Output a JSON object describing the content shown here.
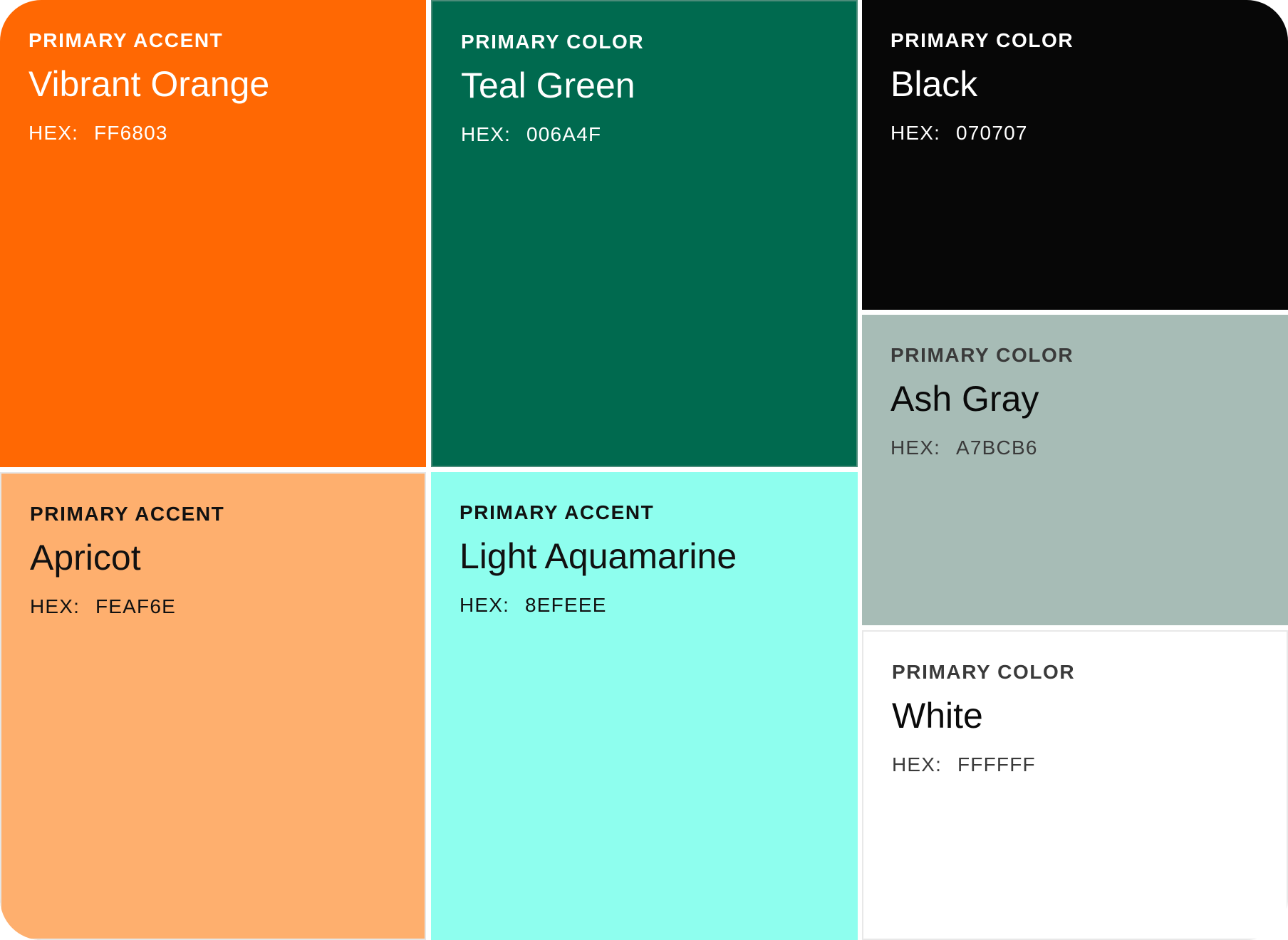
{
  "swatches": [
    {
      "id": "orange",
      "role": "PRIMARY ACCENT",
      "name": "Vibrant Orange",
      "hex_label": "HEX:",
      "hex": "FF6803",
      "bg": "#FF6803",
      "text_color": "#FFFFFF"
    },
    {
      "id": "teal",
      "role": "PRIMARY COLOR",
      "name": "Teal Green",
      "hex_label": "HEX:",
      "hex": "006A4F",
      "bg": "#006A4F",
      "text_color": "#FFFFFF"
    },
    {
      "id": "black",
      "role": "PRIMARY COLOR",
      "name": "Black",
      "hex_label": "HEX:",
      "hex": "070707",
      "bg": "#070707",
      "text_color": "#FFFFFF"
    },
    {
      "id": "apricot",
      "role": "PRIMARY ACCENT",
      "name": "Apricot",
      "hex_label": "HEX:",
      "hex": "FEAF6E",
      "bg": "#FEAF6E",
      "text_color": "#111111"
    },
    {
      "id": "aqua",
      "role": "PRIMARY ACCENT",
      "name": "Light Aquamarine",
      "hex_label": "HEX:",
      "hex": "8EFEEE",
      "bg": "#8EFEEE",
      "text_color": "#111111"
    },
    {
      "id": "ash",
      "role": "PRIMARY COLOR",
      "name": "Ash Gray",
      "hex_label": "HEX:",
      "hex": "A7BCB6",
      "bg": "#A7BCB6",
      "text_color": "#3A3A3A"
    },
    {
      "id": "white",
      "role": "PRIMARY COLOR",
      "name": "White",
      "hex_label": "HEX:",
      "hex": "FFFFFF",
      "bg": "#FFFFFF",
      "text_color": "#3A3A3A"
    }
  ]
}
